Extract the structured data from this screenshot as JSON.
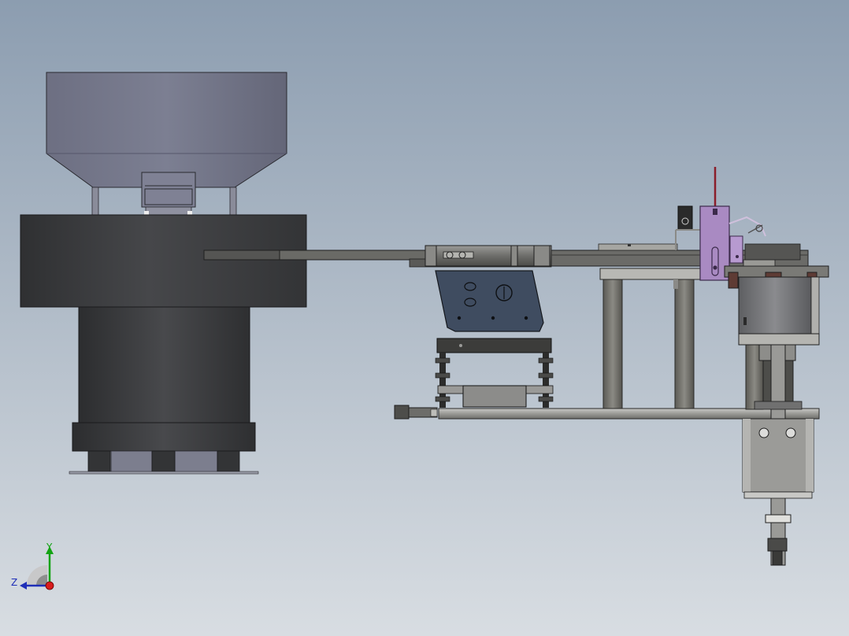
{
  "viewport": {
    "background_top": "#8c9db0",
    "background_bottom": "#d8dde2"
  },
  "triad": {
    "y_label": "Y",
    "z_label": "Z",
    "y_color": "#12a312",
    "z_color": "#1f2fb8",
    "x_color": "#d81c1c"
  },
  "model": {
    "name_icon": "assembly-model-icon",
    "accent_color": "#a98ac2",
    "dark_body": "#3b3c3e",
    "bracket_color": "#3f4c60"
  }
}
